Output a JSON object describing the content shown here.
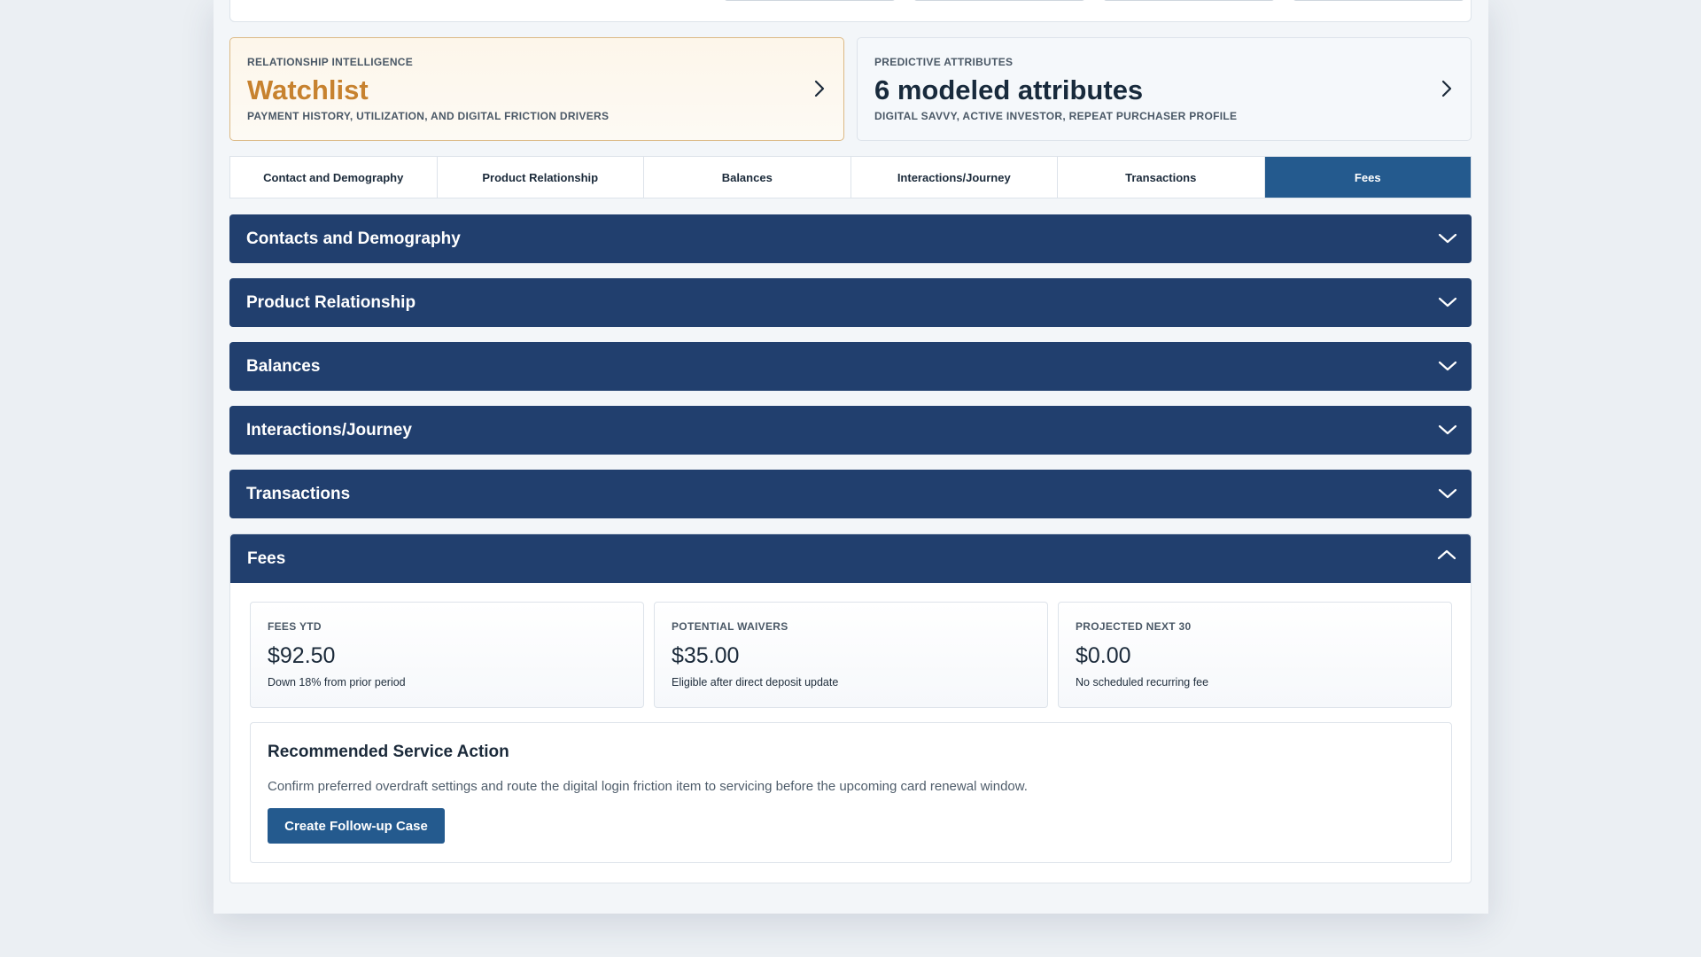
{
  "summary_cards": {
    "relationship": {
      "eyebrow": "RELATIONSHIP INTELLIGENCE",
      "title": "Watchlist",
      "subtitle": "PAYMENT HISTORY, UTILIZATION, AND DIGITAL FRICTION DRIVERS",
      "icon": "chevron-right-icon"
    },
    "predictive": {
      "eyebrow": "PREDICTIVE ATTRIBUTES",
      "title": "6 modeled attributes",
      "subtitle": "DIGITAL SAVVY, ACTIVE INVESTOR, REPEAT PURCHASER PROFILE",
      "icon": "chevron-right-icon"
    }
  },
  "tabs": [
    {
      "label": "Contact and Demography",
      "active": false
    },
    {
      "label": "Product Relationship",
      "active": false
    },
    {
      "label": "Balances",
      "active": false
    },
    {
      "label": "Interactions/Journey",
      "active": false
    },
    {
      "label": "Transactions",
      "active": false
    },
    {
      "label": "Fees",
      "active": true
    }
  ],
  "sections": [
    {
      "title": "Contacts and Demography",
      "expanded": false
    },
    {
      "title": "Product Relationship",
      "expanded": false
    },
    {
      "title": "Balances",
      "expanded": false
    },
    {
      "title": "Interactions/Journey",
      "expanded": false
    },
    {
      "title": "Transactions",
      "expanded": false
    },
    {
      "title": "Fees",
      "expanded": true
    }
  ],
  "fees": {
    "metrics": [
      {
        "label": "FEES YTD",
        "value": "$92.50",
        "note": "Down 18% from prior period"
      },
      {
        "label": "POTENTIAL WAIVERS",
        "value": "$35.00",
        "note": "Eligible after direct deposit update"
      },
      {
        "label": "PROJECTED NEXT 30",
        "value": "$0.00",
        "note": "No scheduled recurring fee"
      }
    ],
    "action": {
      "title": "Recommended Service Action",
      "text": "Confirm preferred overdraft settings and route the digital login friction item to servicing before the upcoming card renewal window.",
      "button_label": "Create Follow-up Case"
    }
  },
  "colors": {
    "accent_navy": "#213f6e",
    "active_tab": "#245a8e",
    "watchlist_orange": "#c7822f"
  }
}
